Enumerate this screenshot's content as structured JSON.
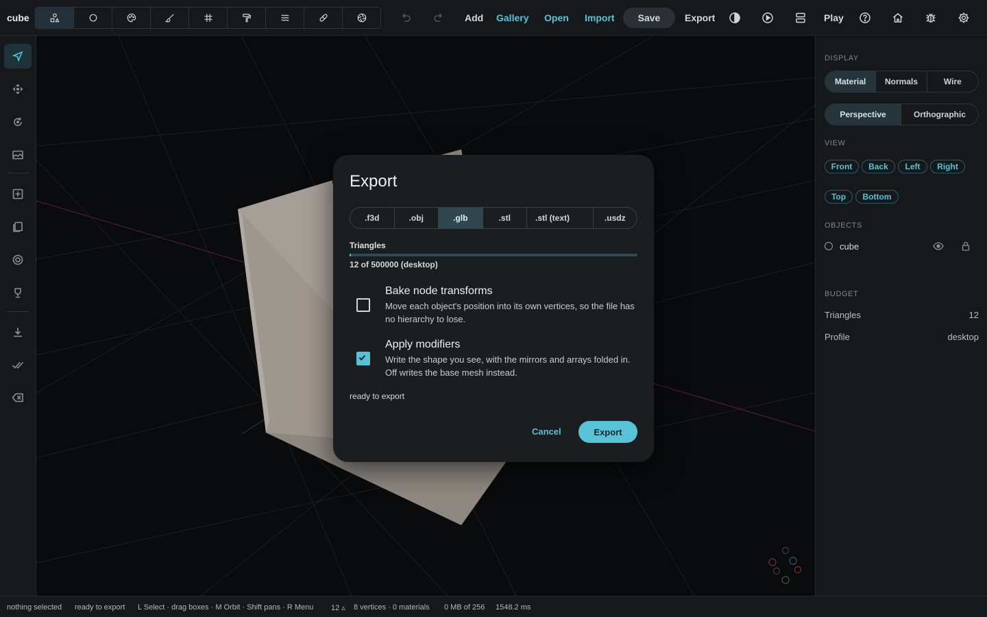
{
  "app": {
    "title": "cube"
  },
  "topbar": {
    "tools": [
      {
        "icon": "shapes-icon",
        "active": true
      },
      {
        "icon": "circle-icon"
      },
      {
        "icon": "palette-icon"
      },
      {
        "icon": "brush-icon"
      },
      {
        "icon": "grid-icon"
      },
      {
        "icon": "paint-roller-icon"
      },
      {
        "icon": "waves-icon"
      },
      {
        "icon": "bandage-icon"
      },
      {
        "icon": "aperture-icon"
      }
    ],
    "undo_icon": "undo-icon",
    "redo_icon": "redo-icon",
    "add_label": "Add",
    "gallery_label": "Gallery",
    "open_label": "Open",
    "import_label": "Import",
    "save_label": "Save",
    "export_label": "Export",
    "play_label": "Play",
    "accent": "#58c3d6"
  },
  "leftbar": {
    "tools": [
      "select-icon",
      "move-icon",
      "rotate-icon",
      "image-icon",
      "add-box-icon",
      "copy-icon",
      "target-icon",
      "trophy-icon",
      "download-icon",
      "double-check-icon",
      "backspace-icon"
    ]
  },
  "rightpanel": {
    "display_heading": "DISPLAY",
    "display_modes": [
      "Material",
      "Normals",
      "Wire"
    ],
    "display_active": "Material",
    "projections": [
      "Perspective",
      "Orthographic"
    ],
    "projection_active": "Perspective",
    "view_heading": "VIEW",
    "views": [
      "Front",
      "Back",
      "Left",
      "Right",
      "Top",
      "Bottom"
    ],
    "objects_heading": "OBJECTS",
    "objects": [
      {
        "name": "cube"
      }
    ],
    "budget_heading": "BUDGET",
    "budget": {
      "triangles_label": "Triangles",
      "triangles_value": "12",
      "profile_label": "Profile",
      "profile_value": "desktop"
    }
  },
  "dialog": {
    "title": "Export",
    "formats": [
      ".f3d",
      ".obj",
      ".glb",
      ".stl",
      ".stl (text)",
      ".usdz"
    ],
    "active_format": ".glb",
    "triangles_label": "Triangles",
    "triangle_fraction": 2.4e-05,
    "triangles_text": "12 of 500000 (desktop)",
    "options": [
      {
        "title": "Bake node transforms",
        "description": "Move each object's position into its own vertices, so the file has no hierarchy to lose.",
        "checked": false
      },
      {
        "title": "Apply modifiers",
        "description": "Write the shape you see, with the mirrors and arrays folded in. Off writes the base mesh instead.",
        "checked": true
      }
    ],
    "status": "ready to export",
    "cancel_label": "Cancel",
    "export_label": "Export"
  },
  "statusbar": {
    "selection": "nothing selected",
    "state": "ready to export",
    "hints": "L Select · drag boxes · M Orbit · Shift pans · R Menu",
    "tri_count": "12 ▵",
    "stats": "8 vertices · 0 materials",
    "memory": "0 MB of 256",
    "frame_time": "1548.2 ms"
  }
}
